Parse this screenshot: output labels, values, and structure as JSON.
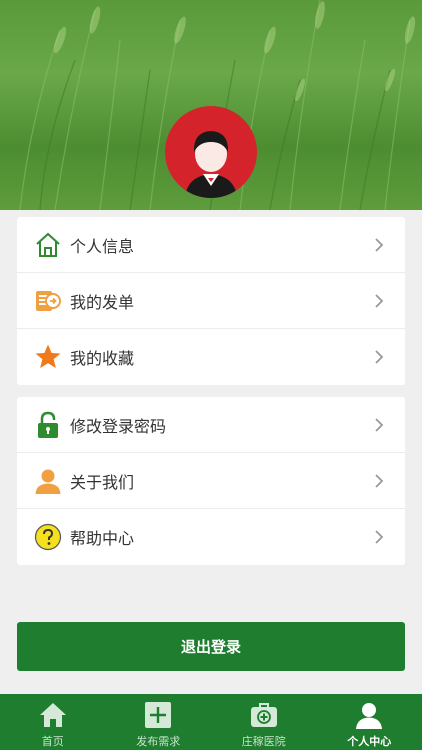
{
  "menu_group_1": [
    {
      "label": "个人信息",
      "icon": "home-icon"
    },
    {
      "label": "我的发单",
      "icon": "orders-icon"
    },
    {
      "label": "我的收藏",
      "icon": "star-icon"
    }
  ],
  "menu_group_2": [
    {
      "label": "修改登录密码",
      "icon": "lock-icon"
    },
    {
      "label": "关于我们",
      "icon": "person-icon"
    },
    {
      "label": "帮助中心",
      "icon": "help-icon"
    }
  ],
  "logout_label": "退出登录",
  "tabs": [
    {
      "label": "首页",
      "icon": "home-tab-icon"
    },
    {
      "label": "发布需求",
      "icon": "plus-tab-icon"
    },
    {
      "label": "庄稼医院",
      "icon": "medical-kit-icon"
    },
    {
      "label": "个人中心",
      "icon": "user-tab-icon",
      "active": true
    }
  ],
  "colors": {
    "primary_green": "#1e7d2e",
    "avatar_red": "#d5232b",
    "star_orange": "#f07a1a",
    "orders_orange": "#f0a040",
    "lock_green": "#2e8b2e",
    "person_orange": "#f0a040",
    "help_yellow": "#f5e020"
  }
}
